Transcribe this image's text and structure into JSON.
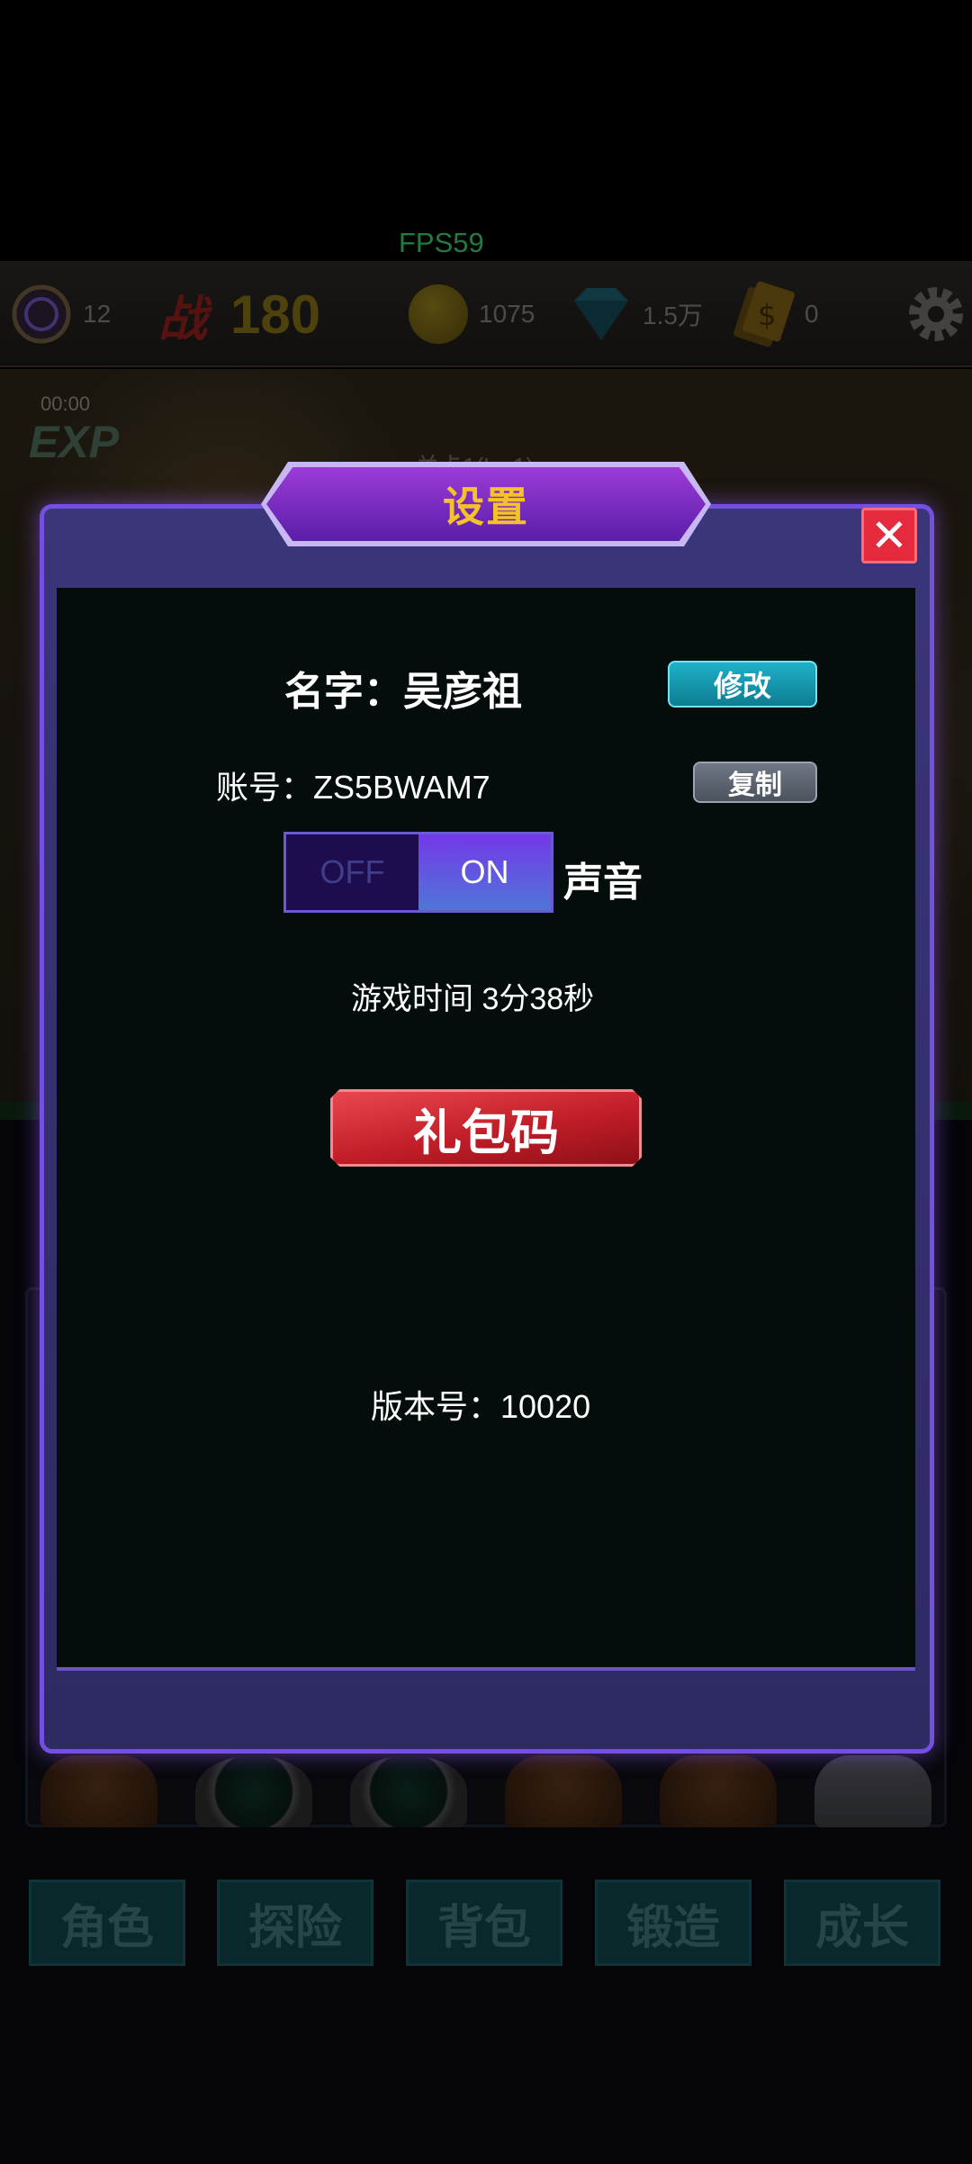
{
  "fps": "FPS59",
  "topbar": {
    "level": "12",
    "battle_label": "战",
    "battle_power": "180",
    "gold": "1075",
    "diamonds": "1.5万",
    "cash": "0"
  },
  "scene": {
    "exp_timer": "00:00",
    "exp_label": "EXP",
    "stage_label": "关卡1(Lv.1)"
  },
  "modal": {
    "title": "设置",
    "close": "✕",
    "name_label": "名字：吴彦祖",
    "modify_button": "修改",
    "account_label": "账号：ZS5BWAM7",
    "copy_button": "复制",
    "sound_off": "OFF",
    "sound_on": "ON",
    "sound_label": "声音",
    "play_time": "游戏时间 3分38秒",
    "gift_code_button": "礼包码",
    "version": "版本号：10020"
  },
  "nav": [
    "角色",
    "探险",
    "背包",
    "锻造",
    "成长"
  ],
  "colors": {
    "accent_purple": "#7350e0",
    "title_gold": "#f6c22a",
    "close_red": "#e52a3d",
    "modify_teal": "#1fb0c8",
    "gift_red": "#c11d28"
  },
  "icons": [
    "level-badge-icon",
    "gold-coin-icon",
    "diamond-icon",
    "cash-ticket-icon",
    "gear-icon"
  ]
}
